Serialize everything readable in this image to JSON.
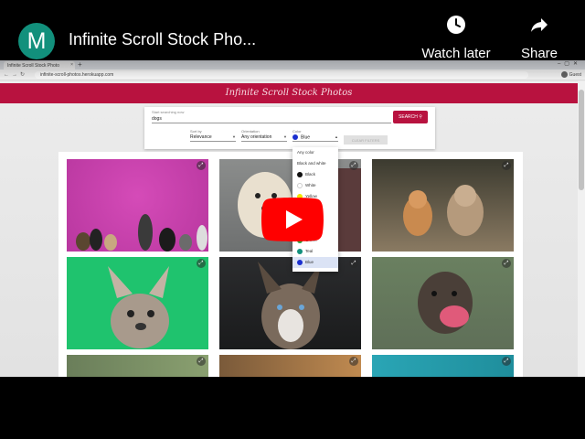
{
  "overlay": {
    "channel_initial": "M",
    "channel_color": "#12907c",
    "video_title": "Infinite Scroll Stock Pho...",
    "watch_later_label": "Watch later",
    "share_label": "Share",
    "play_color": "#ff0000"
  },
  "browser": {
    "tab_title": "Infinite Scroll Stock Photo",
    "tab_close": "×",
    "new_tab": "+",
    "url": "infinite-scroll-photos.herokuapp.com",
    "profile_label": "Guest"
  },
  "site": {
    "title": "Infinite Scroll Stock Photos",
    "header_color": "#b8123f",
    "search": {
      "label": "Start searching now",
      "value": "dogs",
      "button_label": "SEARCH"
    },
    "filters": {
      "sort": {
        "label": "Sort by",
        "value": "Relevance"
      },
      "orientation": {
        "label": "Orientation",
        "value": "Any orientation"
      },
      "color": {
        "label": "Color",
        "value": "Blue",
        "value_color": "#1a2fcf"
      },
      "clear_label": "CLEAR FILTERS"
    },
    "color_menu": [
      {
        "label": "Any color",
        "color": ""
      },
      {
        "label": "Black and white",
        "color": ""
      },
      {
        "label": "Black",
        "color": "#111111"
      },
      {
        "label": "White",
        "color": "#ffffff"
      },
      {
        "label": "Yellow",
        "color": "#f2e600"
      },
      {
        "label": "Orange",
        "color": "#f28c00"
      },
      {
        "label": "Red",
        "color": "#d81b1b"
      },
      {
        "label": "Purple",
        "color": "#7b1fa2"
      },
      {
        "label": "Green",
        "color": "#2e9d3a"
      },
      {
        "label": "Teal",
        "color": "#12907c"
      },
      {
        "label": "Blue",
        "color": "#1a2fcf",
        "selected": true
      }
    ],
    "photos": [
      {
        "subject": "dogs-on-pink"
      },
      {
        "subject": "doodle-dog-on-gray"
      },
      {
        "subject": "corgi-and-terrier-running"
      },
      {
        "subject": "french-bulldog-on-green"
      },
      {
        "subject": "husky-dark"
      },
      {
        "subject": "labrador-licking"
      },
      {
        "subject": "dog-outdoors-blur"
      },
      {
        "subject": "dog-sunlit"
      },
      {
        "subject": "dog-teal-sky"
      }
    ]
  }
}
